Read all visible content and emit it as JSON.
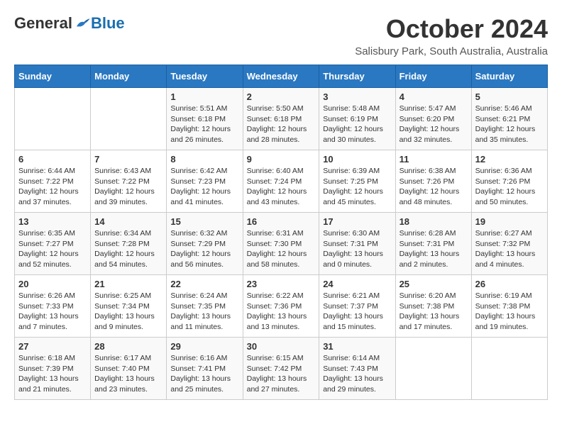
{
  "header": {
    "logo_general": "General",
    "logo_blue": "Blue",
    "month_title": "October 2024",
    "subtitle": "Salisbury Park, South Australia, Australia"
  },
  "days_of_week": [
    "Sunday",
    "Monday",
    "Tuesday",
    "Wednesday",
    "Thursday",
    "Friday",
    "Saturday"
  ],
  "weeks": [
    [
      {
        "day": "",
        "info": ""
      },
      {
        "day": "",
        "info": ""
      },
      {
        "day": "1",
        "info": "Sunrise: 5:51 AM\nSunset: 6:18 PM\nDaylight: 12 hours and 26 minutes."
      },
      {
        "day": "2",
        "info": "Sunrise: 5:50 AM\nSunset: 6:18 PM\nDaylight: 12 hours and 28 minutes."
      },
      {
        "day": "3",
        "info": "Sunrise: 5:48 AM\nSunset: 6:19 PM\nDaylight: 12 hours and 30 minutes."
      },
      {
        "day": "4",
        "info": "Sunrise: 5:47 AM\nSunset: 6:20 PM\nDaylight: 12 hours and 32 minutes."
      },
      {
        "day": "5",
        "info": "Sunrise: 5:46 AM\nSunset: 6:21 PM\nDaylight: 12 hours and 35 minutes."
      }
    ],
    [
      {
        "day": "6",
        "info": "Sunrise: 6:44 AM\nSunset: 7:22 PM\nDaylight: 12 hours and 37 minutes."
      },
      {
        "day": "7",
        "info": "Sunrise: 6:43 AM\nSunset: 7:22 PM\nDaylight: 12 hours and 39 minutes."
      },
      {
        "day": "8",
        "info": "Sunrise: 6:42 AM\nSunset: 7:23 PM\nDaylight: 12 hours and 41 minutes."
      },
      {
        "day": "9",
        "info": "Sunrise: 6:40 AM\nSunset: 7:24 PM\nDaylight: 12 hours and 43 minutes."
      },
      {
        "day": "10",
        "info": "Sunrise: 6:39 AM\nSunset: 7:25 PM\nDaylight: 12 hours and 45 minutes."
      },
      {
        "day": "11",
        "info": "Sunrise: 6:38 AM\nSunset: 7:26 PM\nDaylight: 12 hours and 48 minutes."
      },
      {
        "day": "12",
        "info": "Sunrise: 6:36 AM\nSunset: 7:26 PM\nDaylight: 12 hours and 50 minutes."
      }
    ],
    [
      {
        "day": "13",
        "info": "Sunrise: 6:35 AM\nSunset: 7:27 PM\nDaylight: 12 hours and 52 minutes."
      },
      {
        "day": "14",
        "info": "Sunrise: 6:34 AM\nSunset: 7:28 PM\nDaylight: 12 hours and 54 minutes."
      },
      {
        "day": "15",
        "info": "Sunrise: 6:32 AM\nSunset: 7:29 PM\nDaylight: 12 hours and 56 minutes."
      },
      {
        "day": "16",
        "info": "Sunrise: 6:31 AM\nSunset: 7:30 PM\nDaylight: 12 hours and 58 minutes."
      },
      {
        "day": "17",
        "info": "Sunrise: 6:30 AM\nSunset: 7:31 PM\nDaylight: 13 hours and 0 minutes."
      },
      {
        "day": "18",
        "info": "Sunrise: 6:28 AM\nSunset: 7:31 PM\nDaylight: 13 hours and 2 minutes."
      },
      {
        "day": "19",
        "info": "Sunrise: 6:27 AM\nSunset: 7:32 PM\nDaylight: 13 hours and 4 minutes."
      }
    ],
    [
      {
        "day": "20",
        "info": "Sunrise: 6:26 AM\nSunset: 7:33 PM\nDaylight: 13 hours and 7 minutes."
      },
      {
        "day": "21",
        "info": "Sunrise: 6:25 AM\nSunset: 7:34 PM\nDaylight: 13 hours and 9 minutes."
      },
      {
        "day": "22",
        "info": "Sunrise: 6:24 AM\nSunset: 7:35 PM\nDaylight: 13 hours and 11 minutes."
      },
      {
        "day": "23",
        "info": "Sunrise: 6:22 AM\nSunset: 7:36 PM\nDaylight: 13 hours and 13 minutes."
      },
      {
        "day": "24",
        "info": "Sunrise: 6:21 AM\nSunset: 7:37 PM\nDaylight: 13 hours and 15 minutes."
      },
      {
        "day": "25",
        "info": "Sunrise: 6:20 AM\nSunset: 7:38 PM\nDaylight: 13 hours and 17 minutes."
      },
      {
        "day": "26",
        "info": "Sunrise: 6:19 AM\nSunset: 7:38 PM\nDaylight: 13 hours and 19 minutes."
      }
    ],
    [
      {
        "day": "27",
        "info": "Sunrise: 6:18 AM\nSunset: 7:39 PM\nDaylight: 13 hours and 21 minutes."
      },
      {
        "day": "28",
        "info": "Sunrise: 6:17 AM\nSunset: 7:40 PM\nDaylight: 13 hours and 23 minutes."
      },
      {
        "day": "29",
        "info": "Sunrise: 6:16 AM\nSunset: 7:41 PM\nDaylight: 13 hours and 25 minutes."
      },
      {
        "day": "30",
        "info": "Sunrise: 6:15 AM\nSunset: 7:42 PM\nDaylight: 13 hours and 27 minutes."
      },
      {
        "day": "31",
        "info": "Sunrise: 6:14 AM\nSunset: 7:43 PM\nDaylight: 13 hours and 29 minutes."
      },
      {
        "day": "",
        "info": ""
      },
      {
        "day": "",
        "info": ""
      }
    ]
  ]
}
